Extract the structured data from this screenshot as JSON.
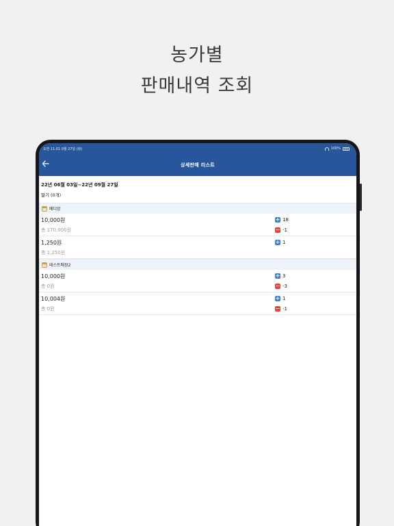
{
  "promo": {
    "line1": "농가별",
    "line2": "판매내역 조회"
  },
  "status_bar": {
    "time": "오전 11:01   9월 27일 (화)",
    "battery": "100%"
  },
  "header": {
    "title": "상세판매 리스트",
    "back_icon": "arrow-left-icon"
  },
  "date_range": "22년 06월 03일~22년 09월 27일",
  "item_header": "딸기 (0개)",
  "stores": [
    {
      "name": "메디앙",
      "rows": [
        {
          "price": "10,000원",
          "total": "총 170,000원",
          "plus": "18",
          "minus": "-1"
        },
        {
          "price": "1,250원",
          "total": "총 1,250원",
          "plus": "1",
          "minus": ""
        }
      ]
    },
    {
      "name": "테스트매장2",
      "rows": [
        {
          "price": "10,000원",
          "total": "총 0원",
          "plus": "3",
          "minus": "-3"
        },
        {
          "price": "10,004원",
          "total": "총 0원",
          "plus": "1",
          "minus": "-1"
        }
      ]
    }
  ],
  "colors": {
    "appbar": "#27569d",
    "plus_badge": "#3f7fd1",
    "minus_badge": "#e0463a"
  }
}
